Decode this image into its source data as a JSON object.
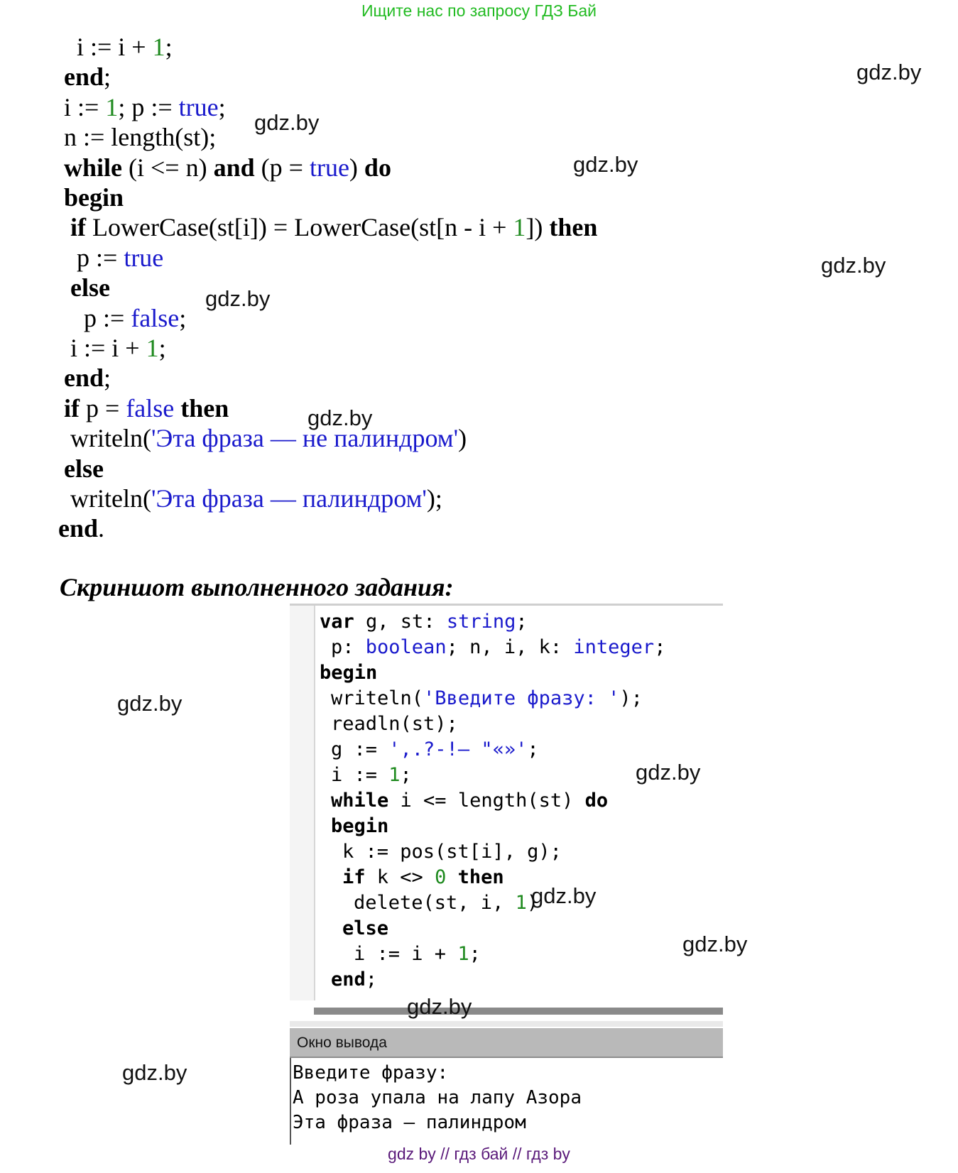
{
  "header": {
    "text": "Ищите нас по запросу ГДЗ Бай"
  },
  "watermark": "gdz.by",
  "code_lines": [
    {
      "parts": [
        {
          "t": "i := i + "
        },
        {
          "t": "1",
          "c": "gn"
        },
        {
          "t": ";"
        }
      ]
    },
    {
      "parts": [
        {
          "t": "end",
          "c": "kw"
        },
        {
          "t": ";"
        }
      ]
    },
    {
      "parts": [
        {
          "t": "i := "
        },
        {
          "t": "1",
          "c": "gn"
        },
        {
          "t": "; p := "
        },
        {
          "t": "true",
          "c": "bl"
        },
        {
          "t": ";"
        }
      ]
    },
    {
      "parts": [
        {
          "t": "n := length(st);"
        }
      ]
    },
    {
      "parts": [
        {
          "t": "while",
          "c": "kw"
        },
        {
          "t": " (i <= n) "
        },
        {
          "t": "and",
          "c": "kw"
        },
        {
          "t": " (p = "
        },
        {
          "t": "true",
          "c": "bl"
        },
        {
          "t": ") "
        },
        {
          "t": "do",
          "c": "kw"
        }
      ]
    },
    {
      "parts": [
        {
          "t": "begin",
          "c": "kw"
        }
      ]
    },
    {
      "parts": [
        {
          "t": "if",
          "c": "kw"
        },
        {
          "t": " LowerCase(st[i]) = LowerCase(st[n - i + "
        },
        {
          "t": "1",
          "c": "gn"
        },
        {
          "t": "]) "
        },
        {
          "t": "then",
          "c": "kw"
        }
      ]
    },
    {
      "parts": [
        {
          "t": "p := "
        },
        {
          "t": "true",
          "c": "bl"
        }
      ]
    },
    {
      "parts": [
        {
          "t": "else",
          "c": "kw"
        }
      ]
    },
    {
      "parts": [
        {
          "t": "p := "
        },
        {
          "t": "false",
          "c": "bl"
        },
        {
          "t": ";"
        }
      ]
    },
    {
      "parts": [
        {
          "t": "i := i + "
        },
        {
          "t": "1",
          "c": "gn"
        },
        {
          "t": ";"
        }
      ]
    },
    {
      "parts": [
        {
          "t": "end",
          "c": "kw"
        },
        {
          "t": ";"
        }
      ]
    },
    {
      "parts": [
        {
          "t": "if",
          "c": "kw"
        },
        {
          "t": " p = "
        },
        {
          "t": "false",
          "c": "bl"
        },
        {
          "t": " "
        },
        {
          "t": "then",
          "c": "kw"
        }
      ]
    },
    {
      "parts": [
        {
          "t": "writeln("
        },
        {
          "t": "'Эта фраза — не палиндром'",
          "c": "bl"
        },
        {
          "t": ")"
        }
      ]
    },
    {
      "parts": [
        {
          "t": "else",
          "c": "kw"
        }
      ]
    },
    {
      "parts": [
        {
          "t": "writeln("
        },
        {
          "t": "'Эта фраза — палиндром'",
          "c": "bl"
        },
        {
          "t": ");"
        }
      ]
    },
    {
      "parts": [
        {
          "t": "end",
          "c": "kw"
        },
        {
          "t": "."
        }
      ]
    }
  ],
  "caption": "Скриншот выполненного задания:",
  "ide_lines": [
    {
      "parts": [
        {
          "t": "var",
          "c": "k"
        },
        {
          "t": " g, st: "
        },
        {
          "t": "string",
          "c": "t"
        },
        {
          "t": ";"
        }
      ]
    },
    {
      "parts": [
        {
          "t": "p: "
        },
        {
          "t": "boolean",
          "c": "t"
        },
        {
          "t": "; n, i, k: "
        },
        {
          "t": "integer",
          "c": "t"
        },
        {
          "t": ";"
        }
      ]
    },
    {
      "parts": [
        {
          "t": "begin",
          "c": "k"
        }
      ]
    },
    {
      "parts": [
        {
          "t": "writeln("
        },
        {
          "t": "'Введите фразу: '",
          "c": "s"
        },
        {
          "t": ");"
        }
      ]
    },
    {
      "parts": [
        {
          "t": "readln(st);"
        }
      ]
    },
    {
      "parts": [
        {
          "t": "g := "
        },
        {
          "t": "',.?-!— \"«»'",
          "c": "s"
        },
        {
          "t": ";"
        }
      ]
    },
    {
      "parts": [
        {
          "t": "i := "
        },
        {
          "t": "1",
          "c": "n"
        },
        {
          "t": ";"
        }
      ]
    },
    {
      "parts": [
        {
          "t": "while",
          "c": "k"
        },
        {
          "t": " i <= length(st) "
        },
        {
          "t": "do",
          "c": "k"
        }
      ]
    },
    {
      "parts": [
        {
          "t": "begin",
          "c": "k"
        }
      ]
    },
    {
      "parts": [
        {
          "t": "k := pos(st[i], g);"
        }
      ]
    },
    {
      "parts": [
        {
          "t": "if",
          "c": "k"
        },
        {
          "t": " k <> "
        },
        {
          "t": "0",
          "c": "n"
        },
        {
          "t": " "
        },
        {
          "t": "then",
          "c": "k"
        }
      ]
    },
    {
      "parts": [
        {
          "t": "delete(st, i, "
        },
        {
          "t": "1",
          "c": "n"
        },
        {
          "t": ")"
        }
      ]
    },
    {
      "parts": [
        {
          "t": "else",
          "c": "k"
        }
      ]
    },
    {
      "parts": [
        {
          "t": "i := i + "
        },
        {
          "t": "1",
          "c": "n"
        },
        {
          "t": ";"
        }
      ]
    },
    {
      "parts": [
        {
          "t": "end",
          "c": "k"
        },
        {
          "t": ";"
        }
      ]
    }
  ],
  "output_window": {
    "title": "Окно вывода",
    "lines": [
      "Введите фразу:",
      "А роза упала на лапу Азора",
      "Эта фраза — палиндром"
    ]
  },
  "footer": {
    "text": "gdz by  //  гдз бай  //  гдз by"
  }
}
